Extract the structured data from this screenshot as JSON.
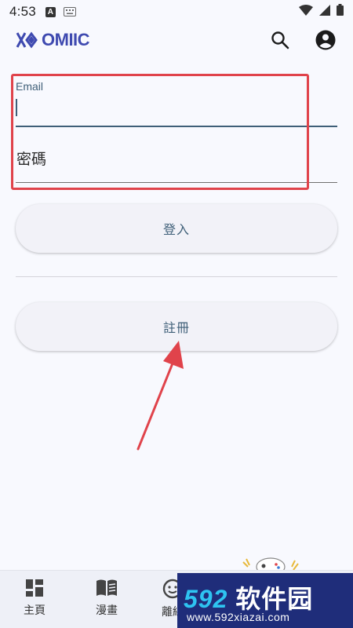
{
  "status_bar": {
    "time": "4:53",
    "notif_letter": "A"
  },
  "app_bar": {
    "logo_text": "OMIIC",
    "search_icon": "search-icon",
    "account_icon": "account-circle-icon"
  },
  "form": {
    "email_label": "Email",
    "email_value": "",
    "password_label": "密碼",
    "password_value": ""
  },
  "buttons": {
    "login": "登入",
    "register": "註冊"
  },
  "bottom_nav": {
    "items": [
      {
        "label": "主頁",
        "icon": "dashboard-icon"
      },
      {
        "label": "漫畫",
        "icon": "book-icon"
      },
      {
        "label": "離線",
        "icon": "offline-icon"
      }
    ]
  },
  "watermark": {
    "title_num": "592",
    "title_cn": "软件园",
    "url": "www.592xiazai.com"
  },
  "colors": {
    "background": "#f8f9fe",
    "accent": "#3f5f78",
    "highlight": "#e0434b",
    "logo": "#3f4ab0",
    "watermark_bg": "#1f2d7a"
  }
}
